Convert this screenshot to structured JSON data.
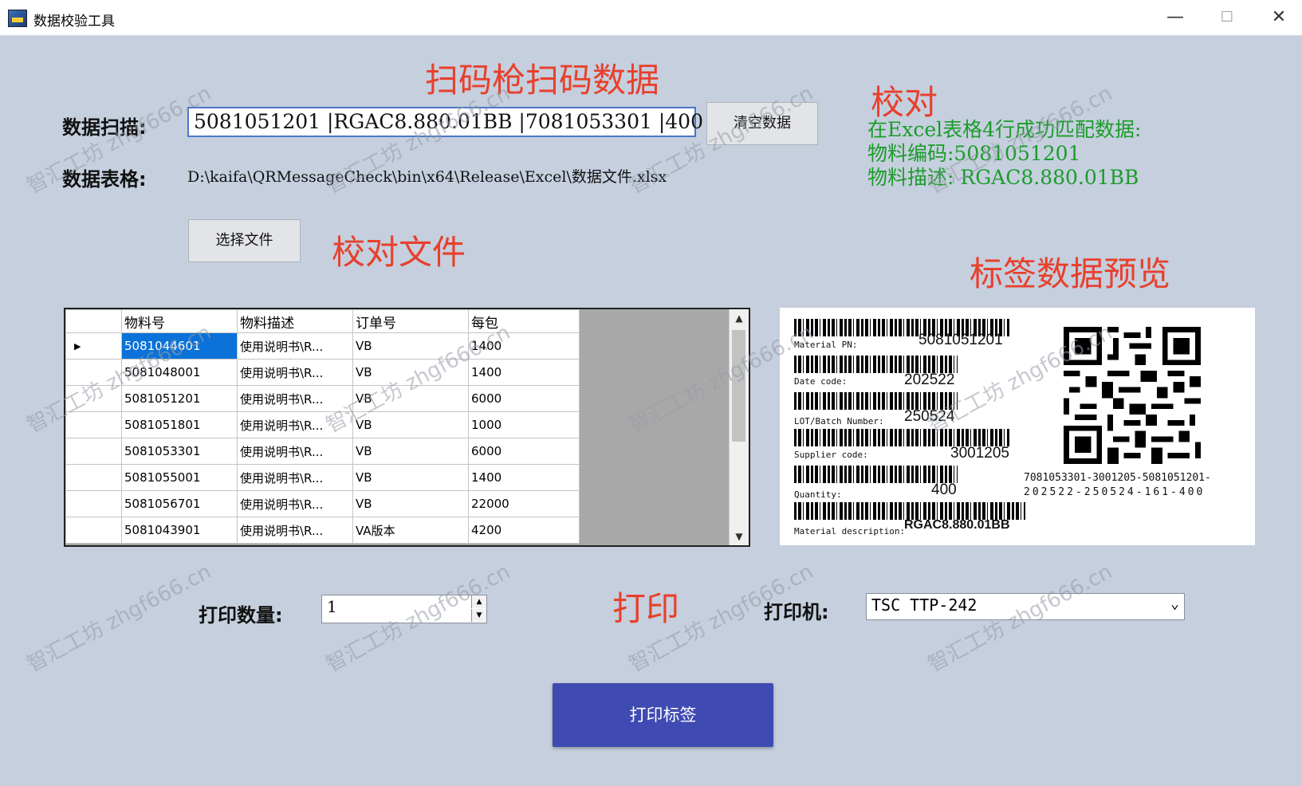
{
  "window": {
    "title": "数据校验工具",
    "minimize": "—",
    "maximize": "☐",
    "close": "✕"
  },
  "annotations": {
    "scan": "扫码枪扫码数据",
    "verify": "校对",
    "file": "校对文件",
    "preview": "标签数据预览",
    "print": "打印"
  },
  "scan": {
    "label": "数据扫描:",
    "value": "5081051201 |RGAC8.880.01BB |7081053301 |400",
    "clear_button": "清空数据"
  },
  "file": {
    "label": "数据表格:",
    "path": "D:\\kaifa\\QRMessageCheck\\bin\\x64\\Release\\Excel\\数据文件.xlsx",
    "select_button": "选择文件"
  },
  "verify": {
    "line1": "在Excel表格4行成功匹配数据:",
    "line2": "物料编码:5081051201",
    "line3": "物料描述: RGAC8.880.01BB"
  },
  "grid": {
    "headers": [
      "物料号",
      "物料描述",
      "订单号",
      "每包"
    ],
    "rows": [
      [
        "5081044601",
        "使用说明书\\R...",
        "VB",
        "1400"
      ],
      [
        "5081048001",
        "使用说明书\\R...",
        "VB",
        "1400"
      ],
      [
        "5081051201",
        "使用说明书\\R...",
        "VB",
        "6000"
      ],
      [
        "5081051801",
        "使用说明书\\R...",
        "VB",
        "1000"
      ],
      [
        "5081053301",
        "使用说明书\\R...",
        "VB",
        "6000"
      ],
      [
        "5081055001",
        "使用说明书\\R...",
        "VB",
        "1400"
      ],
      [
        "5081056701",
        "使用说明书\\R...",
        "VB",
        "22000"
      ],
      [
        "5081043901",
        "使用说明书\\R...",
        "VA版本",
        "4200"
      ]
    ],
    "row_pointer": "▶",
    "scroll_up": "▲",
    "scroll_down": "▼"
  },
  "label": {
    "material_pn_label": "Material PN:",
    "material_pn": "5081051201",
    "date_code_label": "Date code:",
    "date_code": "202522",
    "lot_label": "LOT/Batch Number:",
    "lot": "250524",
    "supplier_label": "Supplier code:",
    "supplier": "3001205",
    "quantity_label": "Quantity:",
    "quantity": "400",
    "desc_label": "Material description:",
    "desc": "RGAC8.880.01BB",
    "qr_line1": "7081053301-3001205-5081051201-",
    "qr_line2": "202522-250524-161-400"
  },
  "print": {
    "qty_label": "打印数量:",
    "qty": "1",
    "printer_label": "打印机:",
    "printer": "TSC TTP-242",
    "button": "打印标签"
  },
  "watermark": "智汇工坊 zhgf666.cn"
}
